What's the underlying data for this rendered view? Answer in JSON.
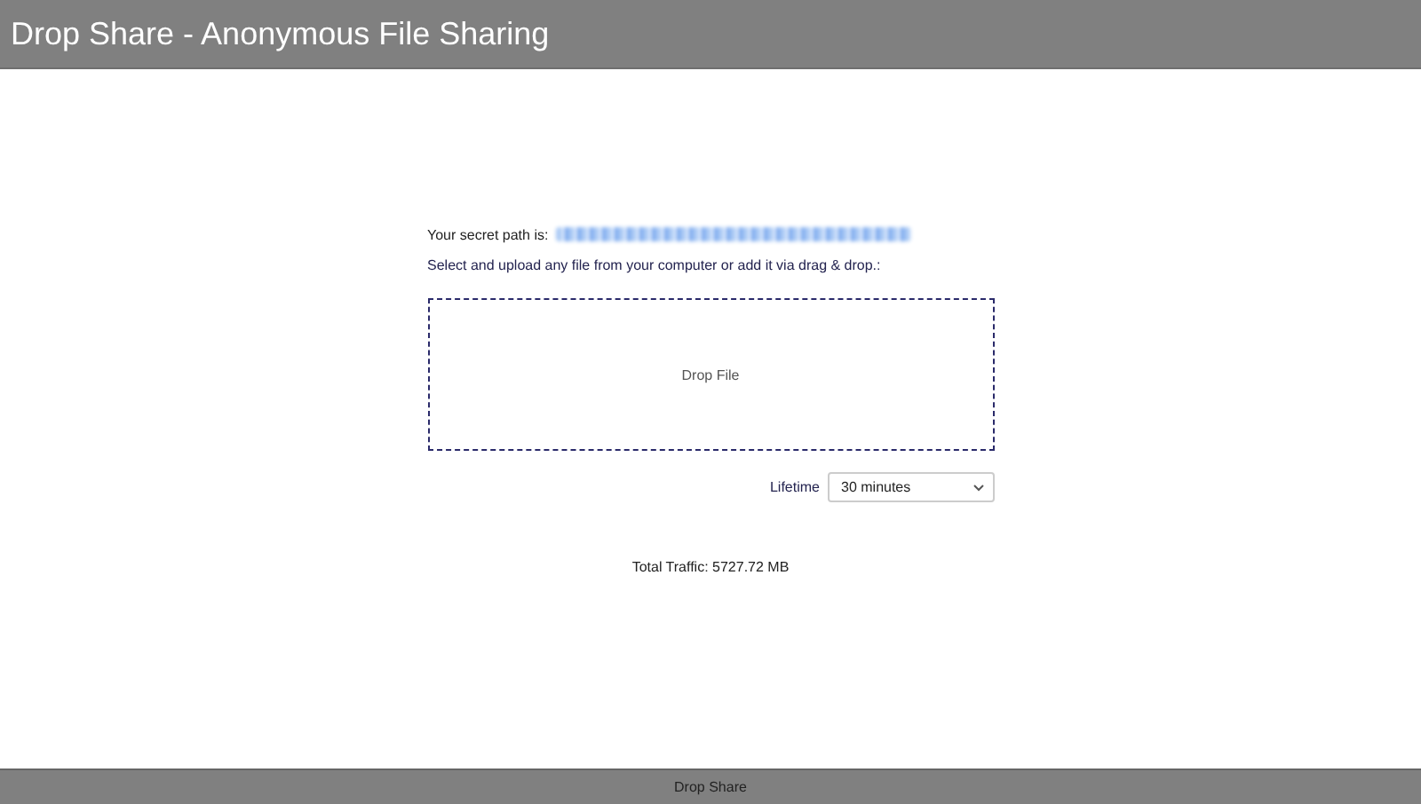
{
  "header": {
    "title": "Drop Share - Anonymous File Sharing"
  },
  "secret_path": {
    "label": "Your secret path is:"
  },
  "instructions": "Select and upload any file from your computer or add it via drag & drop.:",
  "drop_zone": {
    "label": "Drop File"
  },
  "lifetime": {
    "label": "Lifetime",
    "value": "30 minutes"
  },
  "total_traffic": "Total Traffic: 5727.72 MB",
  "footer": {
    "text": "Drop Share"
  }
}
